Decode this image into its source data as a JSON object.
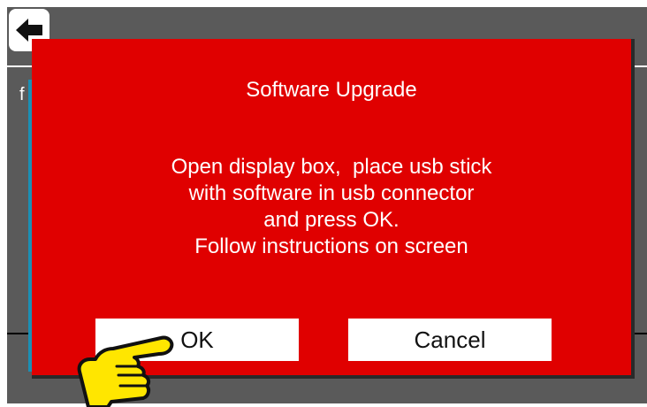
{
  "dialog": {
    "title": "Software Upgrade",
    "message_lines": [
      "Open display box,  place usb stick",
      "with software in usb connector",
      "and press OK.",
      "Follow instructions on screen"
    ],
    "ok_label": "OK",
    "cancel_label": "Cancel",
    "background_color": "#e00000"
  },
  "background_screen": {
    "body_partial_text": "f",
    "color": "#5a5a5a"
  },
  "icons": {
    "back": "back-arrow-icon",
    "pointer": "pointing-hand-icon"
  }
}
